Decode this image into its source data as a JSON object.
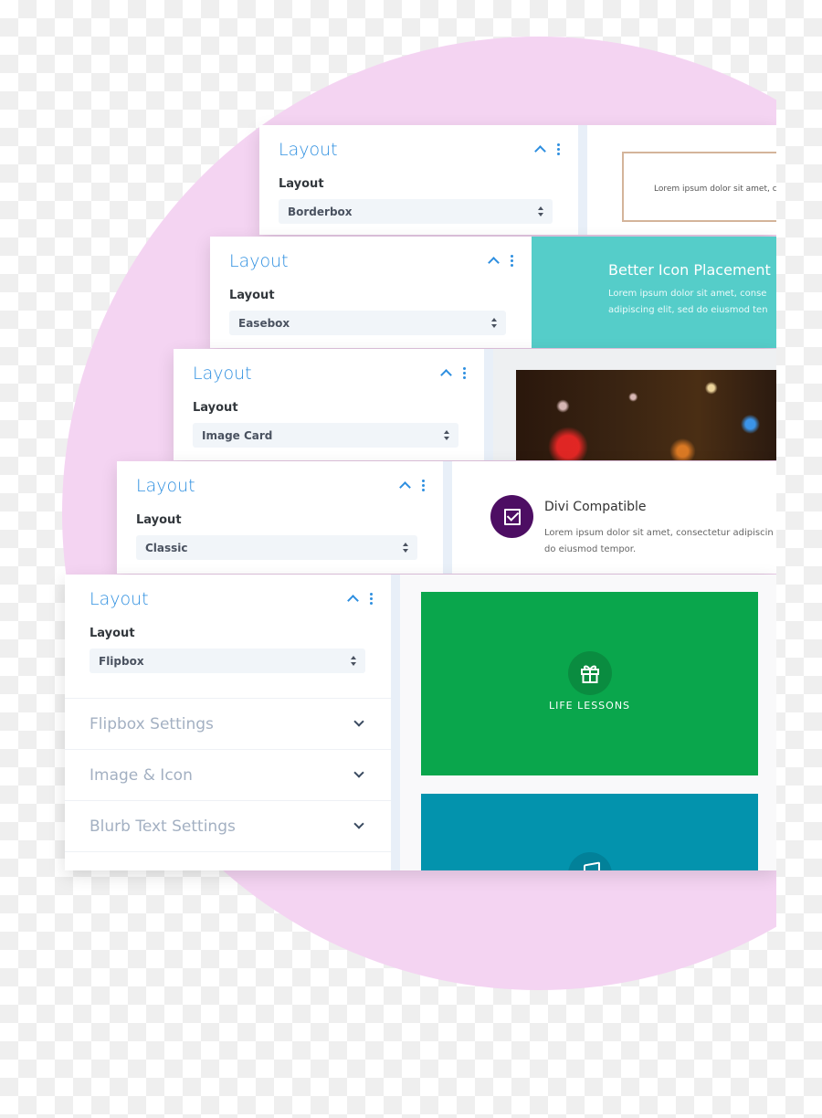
{
  "panels": [
    {
      "title": "Layout",
      "field_label": "Layout",
      "selected": "Borderbox",
      "preview": {
        "type": "borderbox",
        "text": "Lorem ipsum dolor sit amet, c"
      }
    },
    {
      "title": "Layout",
      "field_label": "Layout",
      "selected": "Easebox",
      "preview": {
        "type": "easebox",
        "title": "Better Icon Placement",
        "body_line1": "Lorem ipsum dolor sit amet, conse",
        "body_line2": "adipiscing elit, sed do eiusmod ten",
        "color": "#55cdc9"
      }
    },
    {
      "title": "Layout",
      "field_label": "Layout",
      "selected": "Image Card",
      "preview": {
        "type": "image-card",
        "image": "bokeh-night-lights-photo"
      }
    },
    {
      "title": "Layout",
      "field_label": "Layout",
      "selected": "Classic",
      "preview": {
        "type": "classic",
        "title": "Divi Compatible",
        "body_line1": "Lorem ipsum dolor sit amet, consectetur adipiscin",
        "body_line2": "do eiusmod tempor.",
        "icon": "checkbox-icon",
        "icon_color": "#4d0e63"
      }
    },
    {
      "title": "Layout",
      "field_label": "Layout",
      "selected": "Flipbox",
      "sections": [
        {
          "label": "Flipbox Settings"
        },
        {
          "label": "Image & Icon"
        },
        {
          "label": "Blurb Text Settings"
        }
      ],
      "preview": {
        "type": "flipbox",
        "front_label": "LIFE LESSONS",
        "front_icon": "gift-icon",
        "front_color": "#0aa64c",
        "back_color": "#0393ad",
        "back_icon": "document-icon"
      }
    }
  ],
  "colors": {
    "accent": "#2e8fe0",
    "background_circle": "#f4d4f2"
  }
}
